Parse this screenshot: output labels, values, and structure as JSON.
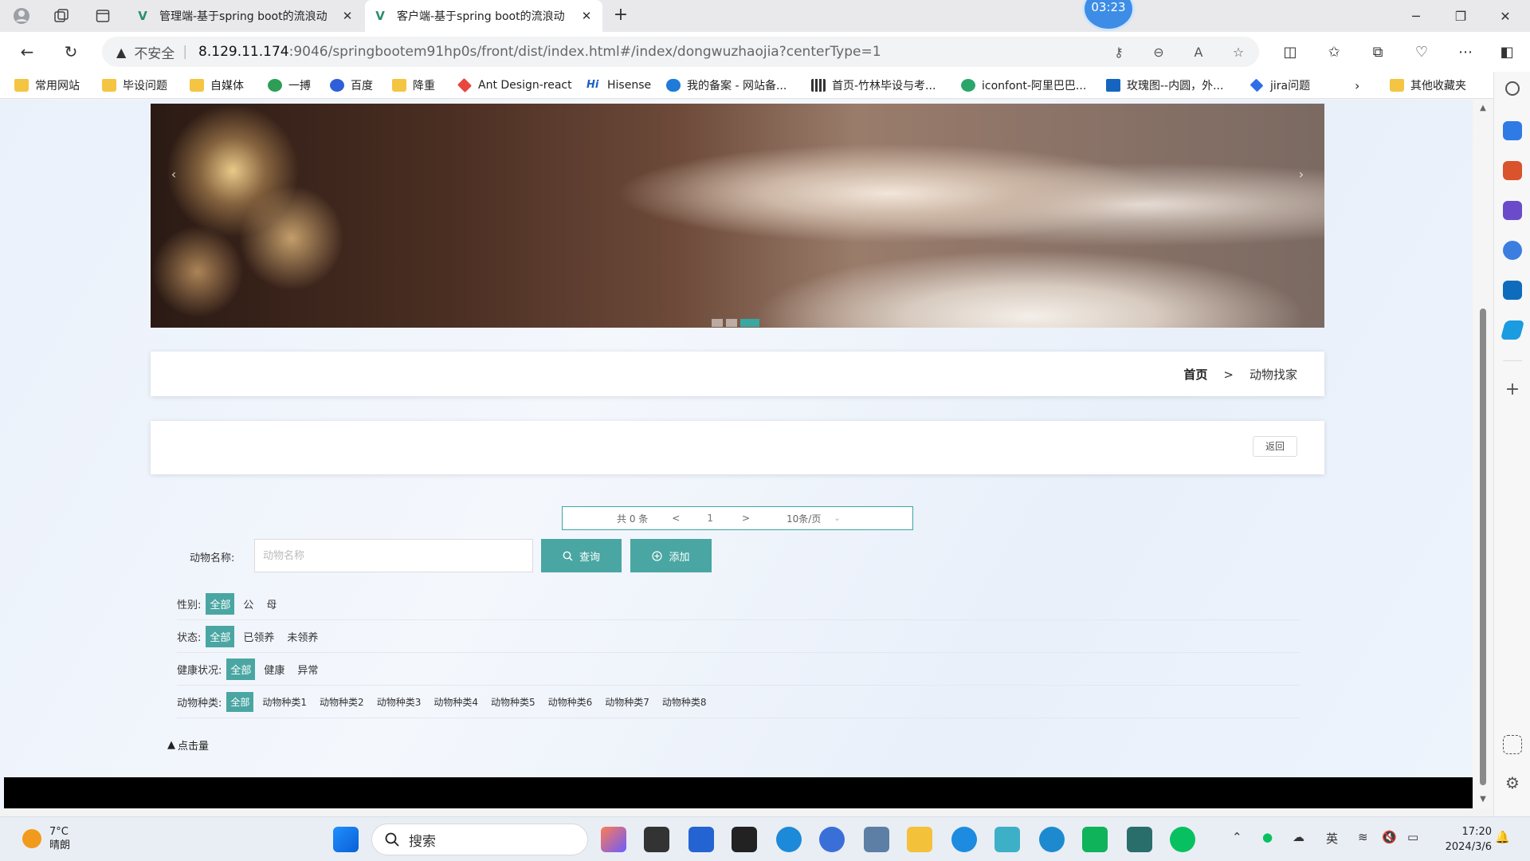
{
  "browser": {
    "tabs": [
      {
        "title": "管理端-基于spring boot的流浪动"
      },
      {
        "title": "客户端-基于spring boot的流浪动"
      }
    ],
    "clock_badge": "03:23",
    "address": {
      "insecure_label": "不安全",
      "url_host": "8.129.11.174",
      "url_path": ":9046/springbootem91hp0s/front/dist/index.html#/index/dongwuzhaojia?centerType=1"
    },
    "bookmarks": [
      {
        "label": "常用网站",
        "icon": "folder"
      },
      {
        "label": "毕设问题",
        "icon": "folder"
      },
      {
        "label": "自媒体",
        "icon": "folder"
      },
      {
        "label": "一搏",
        "icon": "leaf",
        "color": "#2e9e55"
      },
      {
        "label": "百度",
        "icon": "paw",
        "color": "#2f5fd8"
      },
      {
        "label": "降重",
        "icon": "folder"
      },
      {
        "label": "Ant Design-react",
        "icon": "diamond",
        "color": "#e8463f"
      },
      {
        "label": "Hisense",
        "icon": "hi",
        "color": "#1d61c8"
      },
      {
        "label": "我的备案 - 网站备...",
        "icon": "cloud",
        "color": "#1f7bd8"
      },
      {
        "label": "首页-竹林毕设与考...",
        "icon": "bars",
        "color": "#333333"
      },
      {
        "label": "iconfont-阿里巴巴...",
        "icon": "iconfont",
        "color": "#2aa66a"
      },
      {
        "label": "玫瑰图--内圆，外...",
        "icon": "chart",
        "color": "#1565c0"
      },
      {
        "label": "jira问题",
        "icon": "jira",
        "color": "#2e6ee6"
      }
    ],
    "bookmarks_more": "其他收藏夹"
  },
  "page": {
    "breadcrumb": {
      "home": "首页",
      "separator": ">",
      "current": "动物找家"
    },
    "back_button": "返回",
    "pagination": {
      "total": "共 0 条",
      "prev": "<",
      "page": "1",
      "next": ">",
      "page_size": "10条/页"
    },
    "search": {
      "label": "动物名称:",
      "placeholder": "动物名称",
      "query_button": "查询",
      "add_button": "添加"
    },
    "filters": [
      {
        "label": "性别:",
        "options": [
          "全部",
          "公",
          "母"
        ],
        "selected": 0
      },
      {
        "label": "状态:",
        "options": [
          "全部",
          "已领养",
          "未领养"
        ],
        "selected": 0
      },
      {
        "label": "健康状况:",
        "options": [
          "全部",
          "健康",
          "异常"
        ],
        "selected": 0
      },
      {
        "label": "动物种类:",
        "options": [
          "全部",
          "动物种类1",
          "动物种类2",
          "动物种类3",
          "动物种类4",
          "动物种类5",
          "动物种类6",
          "动物种类7",
          "动物种类8"
        ],
        "selected": 0
      }
    ],
    "sort_label": "点击量",
    "theme_color": "#4aa6a2"
  },
  "taskbar": {
    "weather_temp": "7°C",
    "weather_desc": "晴朗",
    "search_placeholder": "搜索",
    "ime": "英",
    "time": "17:20",
    "date": "2024/3/6"
  }
}
